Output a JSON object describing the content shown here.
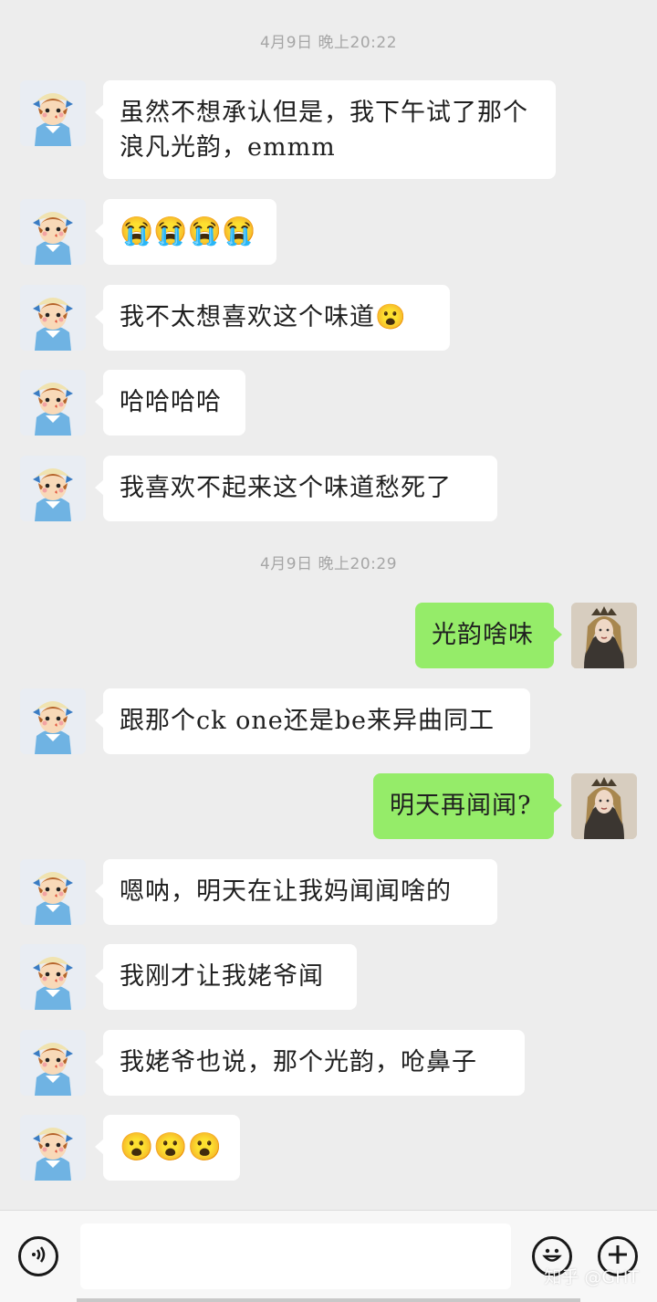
{
  "messages": [
    {
      "type": "timestamp",
      "text": "4月9日  晚上20:22"
    },
    {
      "type": "msg",
      "side": "left",
      "text": "虽然不想承认但是，我下午试了那个浪凡光韵，emmm"
    },
    {
      "type": "msg",
      "side": "left",
      "text": "😭😭😭😭",
      "emoji": true
    },
    {
      "type": "msg",
      "side": "left",
      "text": "我不太想喜欢这个味道😮"
    },
    {
      "type": "msg",
      "side": "left",
      "text": "哈哈哈哈"
    },
    {
      "type": "msg",
      "side": "left",
      "text": "我喜欢不起来这个味道愁死了"
    },
    {
      "type": "timestamp",
      "text": "4月9日  晚上20:29"
    },
    {
      "type": "msg",
      "side": "right",
      "text": "光韵啥味"
    },
    {
      "type": "msg",
      "side": "left",
      "text": "跟那个ck one还是be来异曲同工"
    },
    {
      "type": "msg",
      "side": "right",
      "text": "明天再闻闻?"
    },
    {
      "type": "msg",
      "side": "left",
      "text": "嗯呐，明天在让我妈闻闻啥的"
    },
    {
      "type": "msg",
      "side": "left",
      "text": "我刚才让我姥爷闻"
    },
    {
      "type": "msg",
      "side": "left",
      "text": "我姥爷也说，那个光韵，呛鼻子"
    },
    {
      "type": "msg",
      "side": "left",
      "text": "😮😮😮",
      "emoji": true
    }
  ],
  "input_bar": {
    "voice_icon": "voice-icon",
    "emoji_icon": "emoji-icon",
    "plus_icon": "plus-icon",
    "input_value": ""
  },
  "watermark": "知乎 @GHT",
  "colors": {
    "background": "#ededed",
    "bubble_received": "#ffffff",
    "bubble_sent": "#95ec69"
  }
}
